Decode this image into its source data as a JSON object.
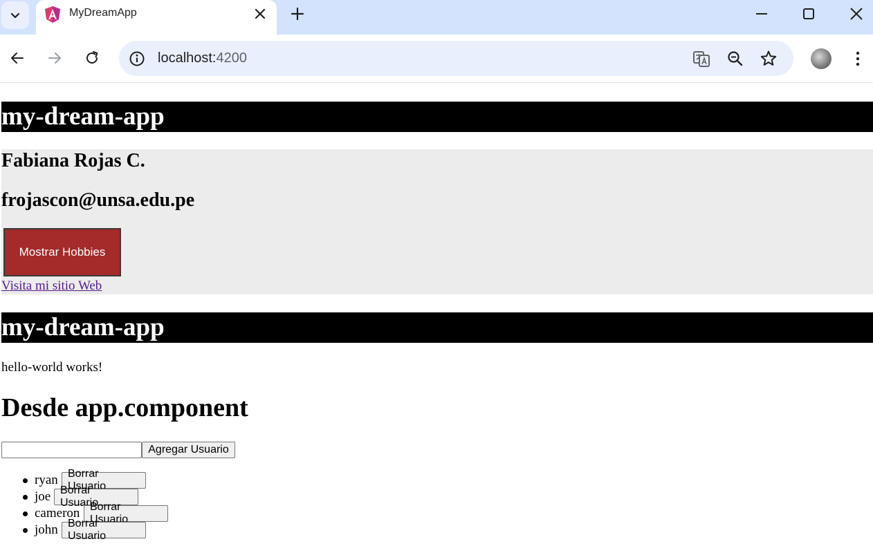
{
  "browser": {
    "tab_title": "MyDreamApp",
    "url_host": "localhost:",
    "url_port": "4200",
    "colors": {
      "tabstrip": "#d3e3fd",
      "omnibox": "#e9effc"
    },
    "icons": [
      "tab-search-icon",
      "angular-favicon-icon",
      "close-icon",
      "plus-icon",
      "minimize-icon",
      "maximize-icon",
      "window-close-icon",
      "back-arrow-icon",
      "forward-arrow-icon",
      "reload-icon",
      "site-info-icon",
      "translate-icon",
      "zoom-icon",
      "star-icon",
      "profile-avatar",
      "kebab-menu-icon"
    ]
  },
  "page": {
    "banner_title_1": "my-dream-app",
    "profile_name": "Fabiana Rojas C.",
    "profile_email": "frojascon@unsa.edu.pe",
    "hobbies_button": "Mostrar Hobbies",
    "site_link": "Visita mi sitio Web",
    "banner_title_2": "my-dream-app",
    "hello_text": "hello-world works!",
    "section_heading": "Desde app.component",
    "user_input_value": "",
    "add_user_button": "Agregar Usuario",
    "users": [
      {
        "name": "ryan",
        "delete_label": "Borrar Usuario"
      },
      {
        "name": "joe",
        "delete_label": "Borrar Usuario"
      },
      {
        "name": "cameron",
        "delete_label": "Borrar Usuario"
      },
      {
        "name": "john",
        "delete_label": "Borrar Usuario"
      }
    ],
    "colors": {
      "banner_bg": "#000000",
      "card_bg": "#ececec",
      "hobbies_button_bg": "#a52a2a",
      "link": "#551a8b"
    }
  }
}
